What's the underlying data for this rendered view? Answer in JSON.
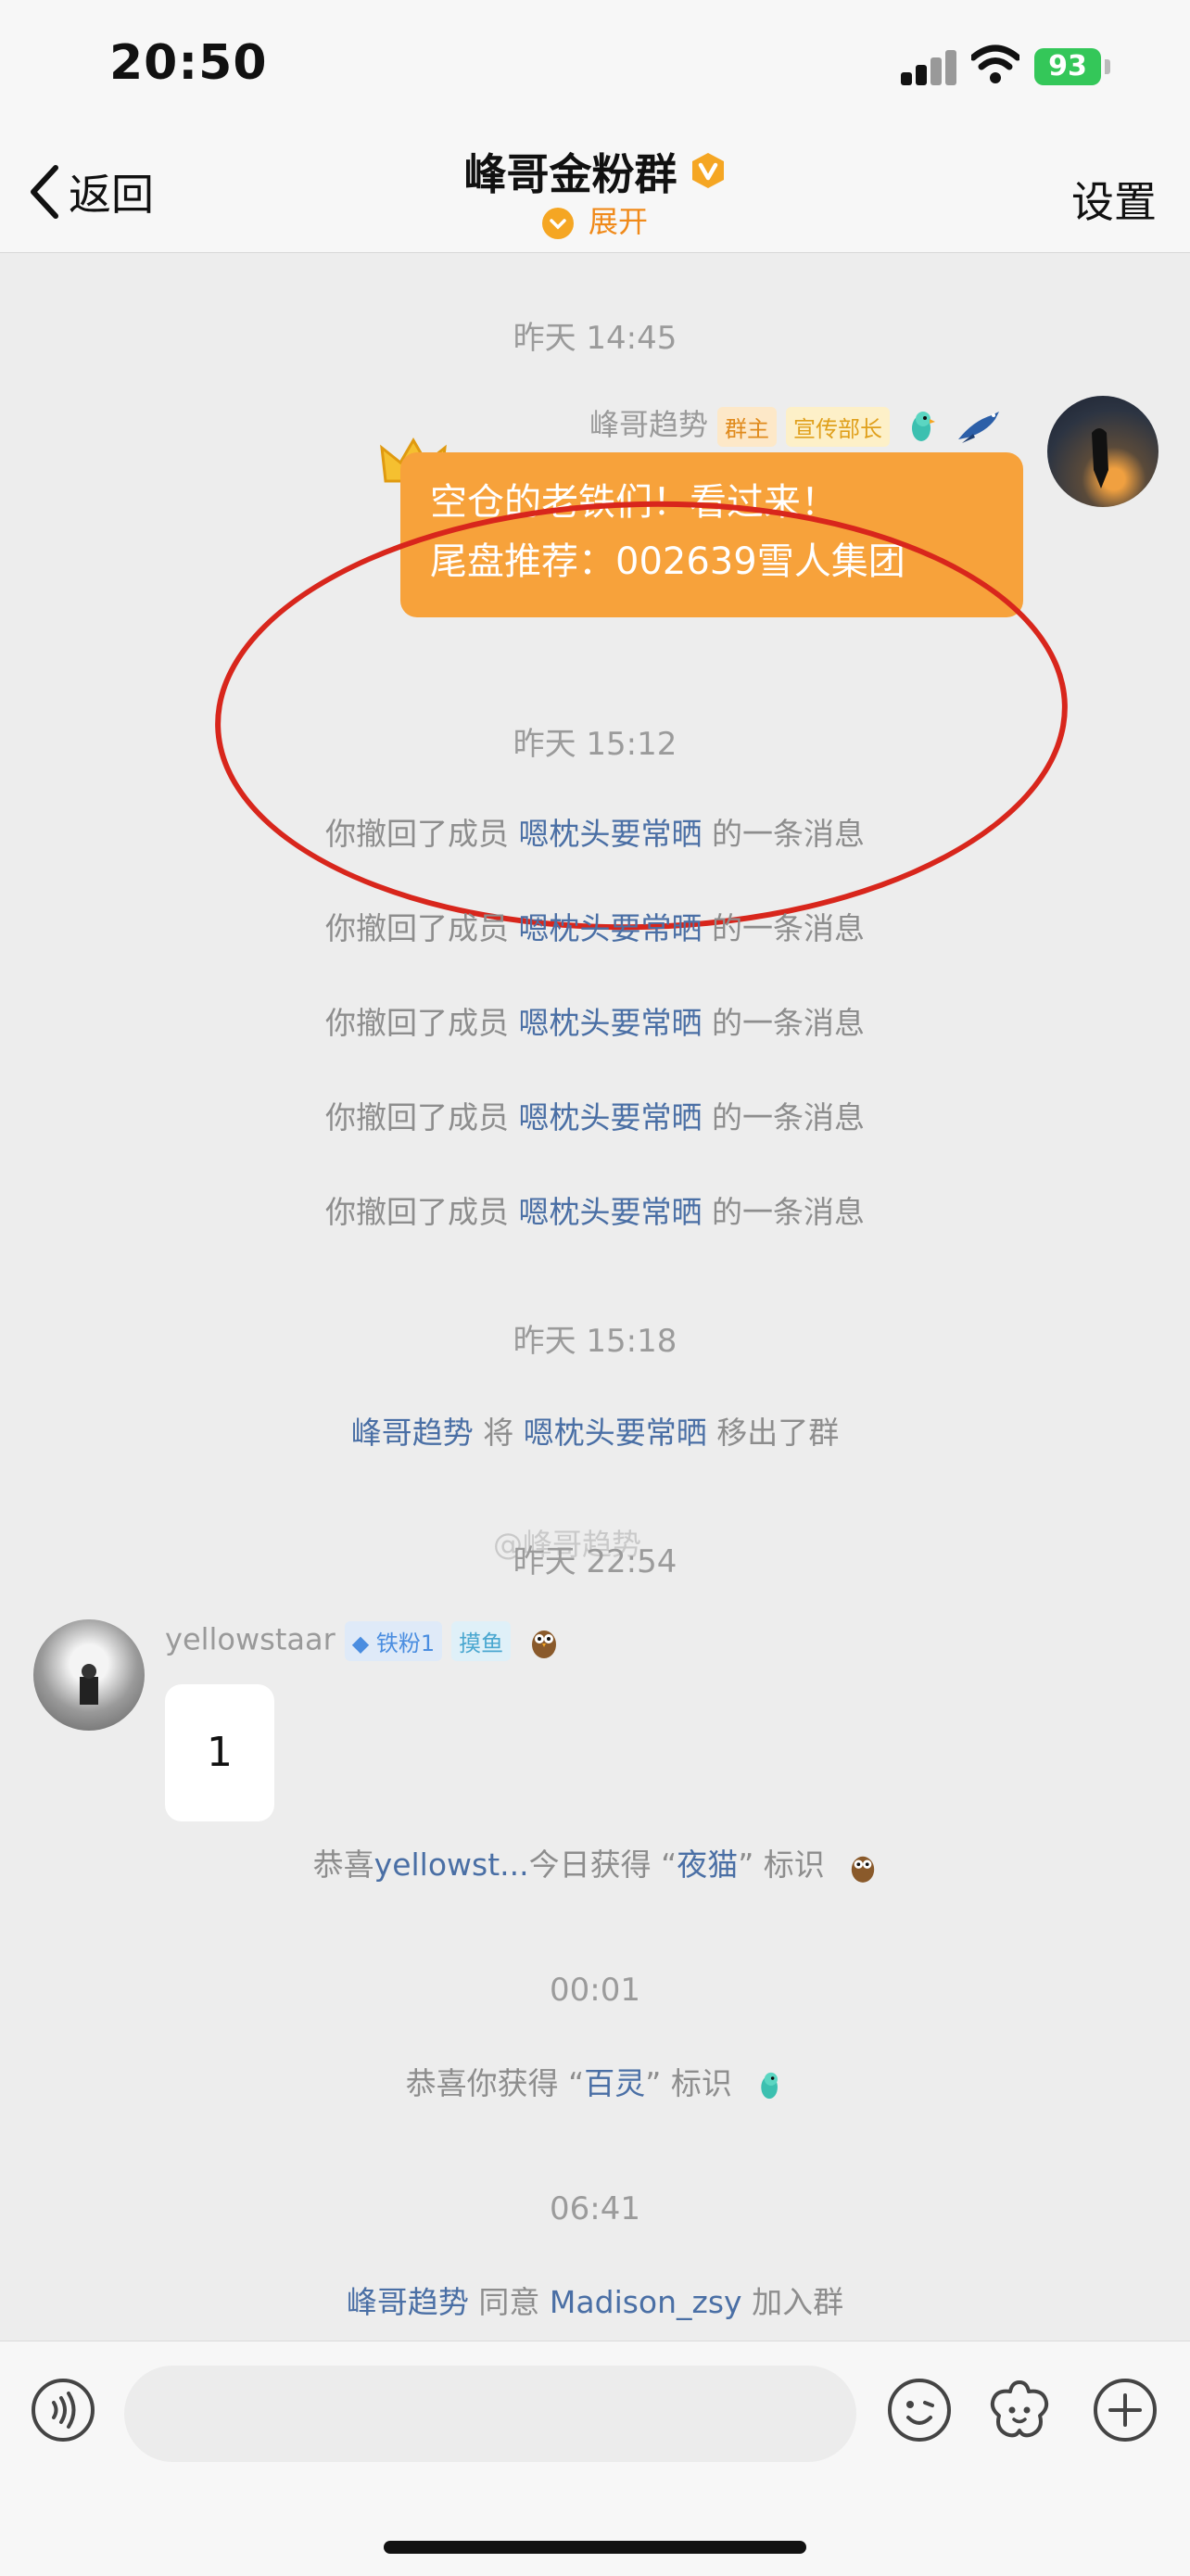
{
  "status_bar": {
    "time": "20:50",
    "battery": "93"
  },
  "header": {
    "back_label": "返回",
    "title": "峰哥金粉群",
    "expand_label": "展开",
    "settings_label": "设置"
  },
  "messages": {
    "ts1": "昨天 14:45",
    "owner": {
      "name": "峰哥趋势",
      "tag_owner": "群主",
      "tag_dept": "宣传部长",
      "line1": "空仓的老铁们！看过来！",
      "line2": "尾盘推荐：002639雪人集团"
    },
    "ts2": "昨天 15:12",
    "recall": {
      "prefix": "你撤回了成员",
      "member": "嗯枕头要常晒",
      "suffix": "的一条消息"
    },
    "watermark": "@峰哥趋势",
    "ts3": "昨天 15:18",
    "removed": {
      "actor": "峰哥趋势",
      "verb": "将",
      "member": "嗯枕头要常晒",
      "suffix": "移出了群"
    },
    "ts4": "昨天 22:54",
    "yellow": {
      "name": "yellowstaar",
      "tag_fan": "铁粉1",
      "tag_fish": "摸鱼",
      "text": "1"
    },
    "congrats_owl": {
      "prefix": "恭喜",
      "user": "yellowst...",
      "middle": "今日获得 “",
      "badge": "夜猫",
      "suffix": "” 标识"
    },
    "ts5": "00:01",
    "congrats_me": {
      "prefix": "恭喜你获得 “",
      "badge": "百灵",
      "suffix": "” 标识"
    },
    "ts6": "06:41",
    "join": {
      "actor": "峰哥趋势",
      "verb": "同意",
      "member": "Madison_zsy",
      "suffix": "加入群"
    }
  },
  "input": {
    "placeholder": ""
  },
  "colors": {
    "bubble_orange": "#f7a23b",
    "link_blue": "#4a6fa5",
    "highlight_red": "#d8261c",
    "accent_orange": "#f08a1a"
  }
}
